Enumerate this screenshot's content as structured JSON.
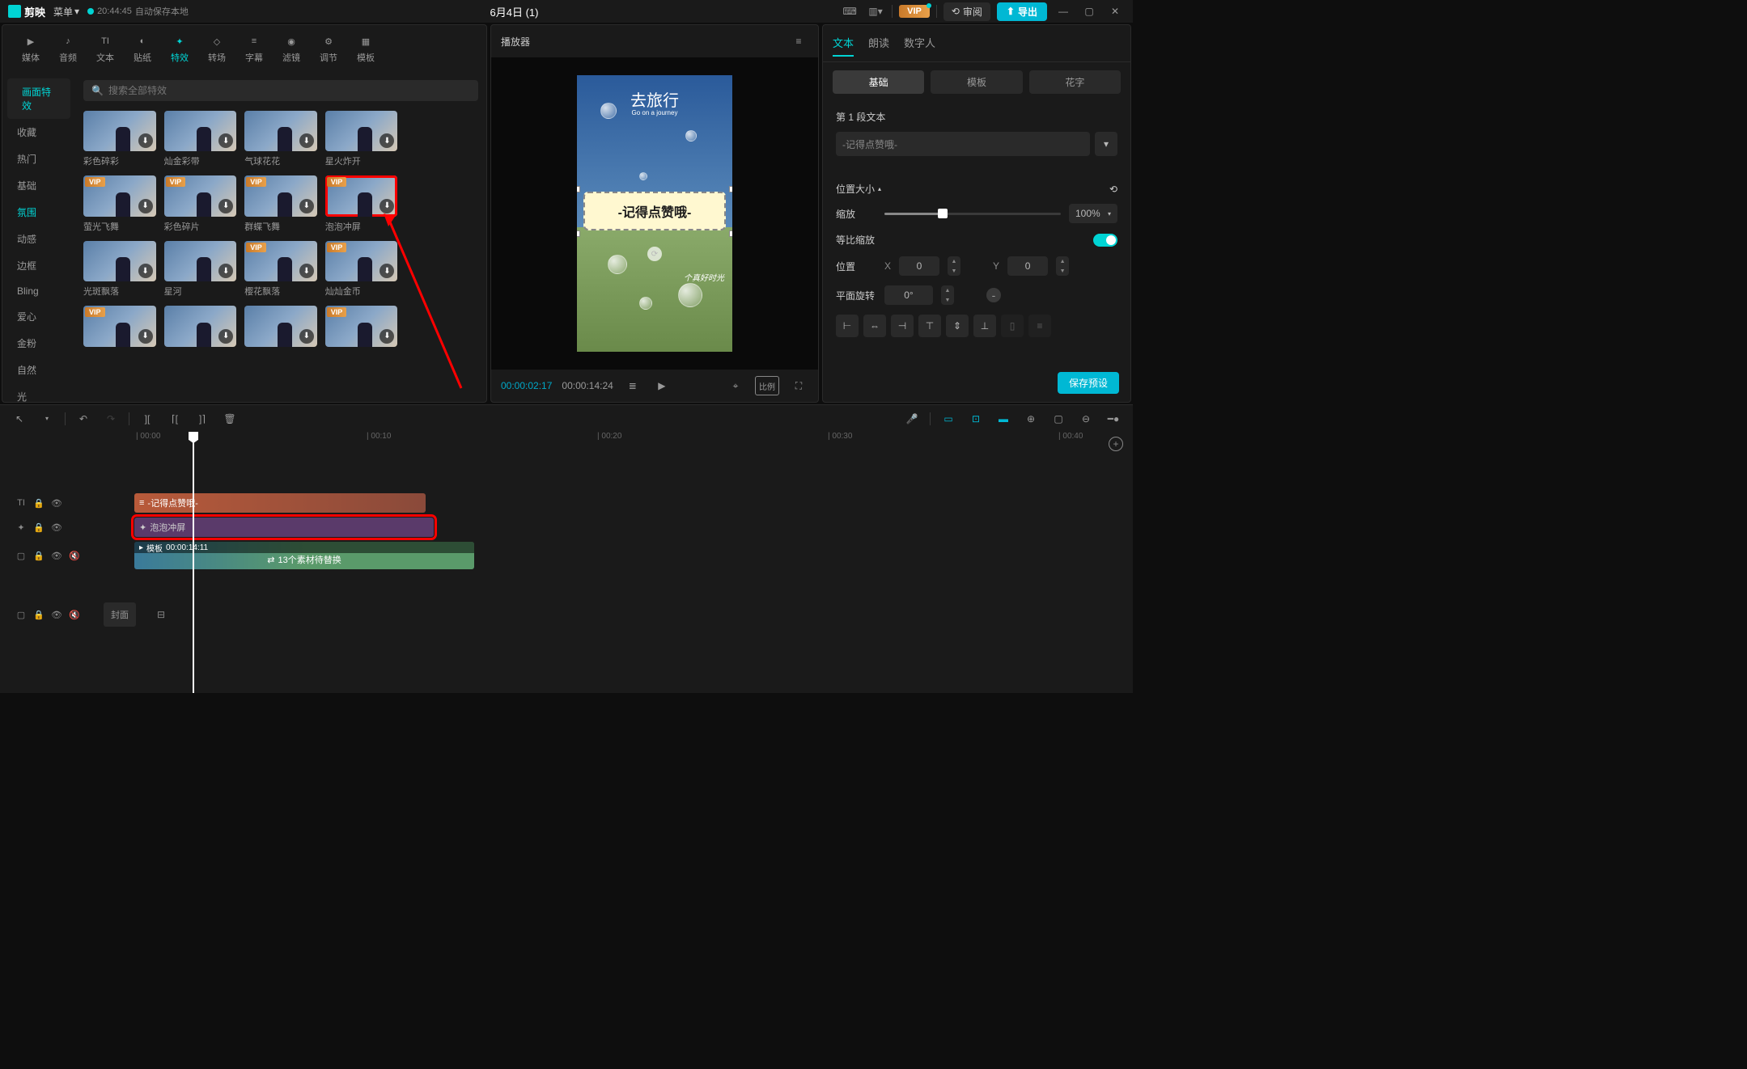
{
  "app": {
    "name": "剪映",
    "menu": "菜单",
    "auto_save_time": "20:44:45",
    "auto_save_text": "自动保存本地",
    "title": "6月4日 (1)"
  },
  "top_right": {
    "vip": "VIP",
    "review": "审阅",
    "export": "导出"
  },
  "nav_tabs": [
    "媒体",
    "音频",
    "文本",
    "贴纸",
    "特效",
    "转场",
    "字幕",
    "滤镜",
    "调节",
    "模板"
  ],
  "nav_active": 4,
  "sidebar_items": [
    "画面特效",
    "收藏",
    "热门",
    "基础",
    "氛围",
    "动感",
    "边框",
    "Bling",
    "爱心",
    "金粉",
    "自然",
    "光"
  ],
  "search_placeholder": "搜索全部特效",
  "effects": [
    {
      "name": "彩色碎彩",
      "vip": false
    },
    {
      "name": "灿金彩带",
      "vip": false
    },
    {
      "name": "气球花花",
      "vip": false
    },
    {
      "name": "星火炸开",
      "vip": false
    },
    {
      "name": "",
      "vip": false
    },
    {
      "name": "萤光飞舞",
      "vip": true
    },
    {
      "name": "彩色碎片",
      "vip": true
    },
    {
      "name": "群蝶飞舞",
      "vip": true
    },
    {
      "name": "泡泡冲屏",
      "vip": true,
      "highlighted": true
    },
    {
      "name": "",
      "vip": false
    },
    {
      "name": "光斑飘落",
      "vip": false
    },
    {
      "name": "星河",
      "vip": false
    },
    {
      "name": "樱花飘落",
      "vip": true
    },
    {
      "name": "灿灿金币",
      "vip": true
    },
    {
      "name": "",
      "vip": false
    },
    {
      "name": "",
      "vip": true
    },
    {
      "name": "",
      "vip": false
    },
    {
      "name": "",
      "vip": false
    },
    {
      "name": "",
      "vip": true
    },
    {
      "name": "",
      "vip": false
    }
  ],
  "player": {
    "header": "播放器",
    "cur_time": "00:00:02:17",
    "total_time": "00:00:14:24",
    "frame_title": "去旅行",
    "frame_sub": "Go on a journey",
    "banner_text": "-记得点赞哦-",
    "script_text": "个真好时光"
  },
  "prop_tabs": [
    "文本",
    "朗读",
    "数字人"
  ],
  "sub_tabs": [
    "基础",
    "模板",
    "花字"
  ],
  "props": {
    "section1_title": "第 1 段文本",
    "text_value": "-记得点赞哦-",
    "section2_title": "位置大小",
    "scale_label": "缩放",
    "scale_value": "100%",
    "propscale_label": "等比缩放",
    "pos_label": "位置",
    "pos_x_label": "X",
    "pos_x": "0",
    "pos_y_label": "Y",
    "pos_y": "0",
    "rot_label": "平面旋转",
    "rot_value": "0°",
    "save_preset": "保存预设"
  },
  "ruler": [
    "00:00",
    "00:10",
    "00:20",
    "00:30",
    "00:40"
  ],
  "tracks": {
    "text_clip": "-记得点赞哦-",
    "effect_clip": "泡泡冲屏",
    "video_duration": "00:00:14:11",
    "video_label": "模板",
    "video_center": "13个素材待替换",
    "cover": "封面"
  }
}
